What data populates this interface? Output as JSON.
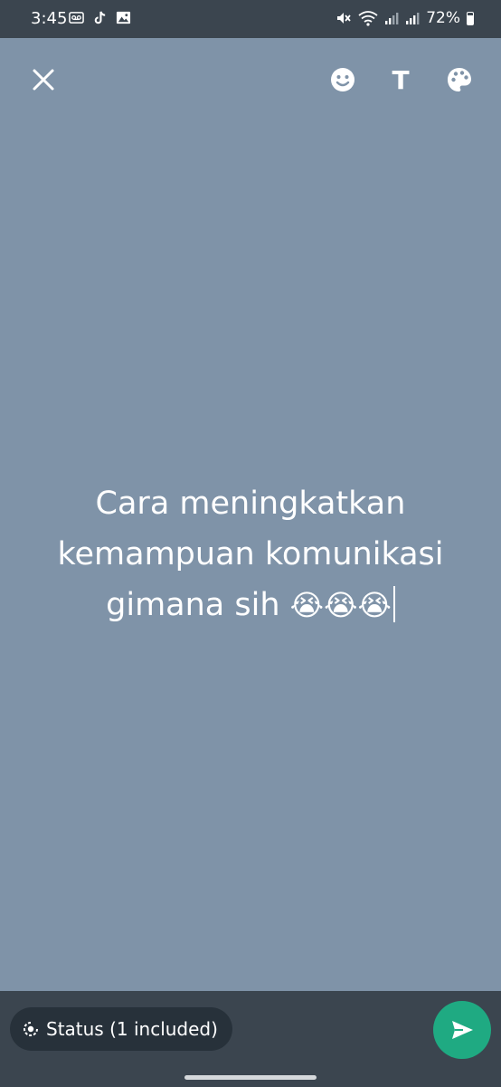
{
  "status_bar": {
    "time": "3:45",
    "battery": "72%",
    "left_icons": [
      "voicemail-icon",
      "tiktok-icon",
      "gallery-icon"
    ],
    "right_icons": [
      "mute-icon",
      "wifi-icon",
      "signal-icon",
      "signal-icon",
      "battery-icon"
    ]
  },
  "toolbar": {
    "close_icon": "close-icon",
    "emoji_icon": "emoji-icon",
    "text_label": "T",
    "palette_icon": "palette-icon"
  },
  "status_text": {
    "line1": "Cara meningkatkan",
    "line2": "kemampuan komunikasi",
    "line3": "gimana sih",
    "emojis": "😭😭😭"
  },
  "bottom": {
    "audience_label": "Status (1 included)",
    "send_icon": "send-icon"
  },
  "colors": {
    "background": "#7f93a8",
    "bars": "#3b454f",
    "send": "#1faa82"
  }
}
